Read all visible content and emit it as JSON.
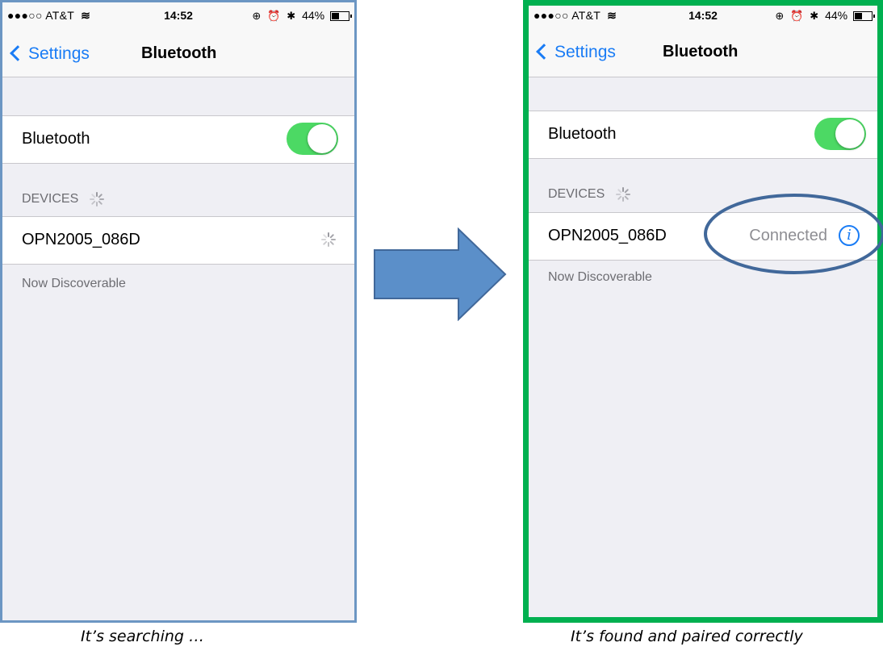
{
  "status_bar": {
    "carrier": "AT&T",
    "signal_dots": "●●●○○",
    "time": "14:52",
    "battery": "44%",
    "battery_level": 0.44
  },
  "nav": {
    "back_label": "Settings",
    "title": "Bluetooth"
  },
  "bluetooth_row": {
    "label": "Bluetooth",
    "enabled": true
  },
  "devices_header": "DEVICES",
  "device": {
    "name": "OPN2005_086D",
    "status": "Connected"
  },
  "footer": "Now Discoverable",
  "captions": {
    "left": "It’s searching …",
    "right": "It’s found and paired correctly"
  },
  "colors": {
    "accent_blue": "#1a7cf5",
    "toggle_green": "#4cd964",
    "left_frame": "#6c96c3",
    "right_frame": "#00b050",
    "arrow": "#5b8fc9",
    "highlight_ellipse": "#41689a"
  }
}
